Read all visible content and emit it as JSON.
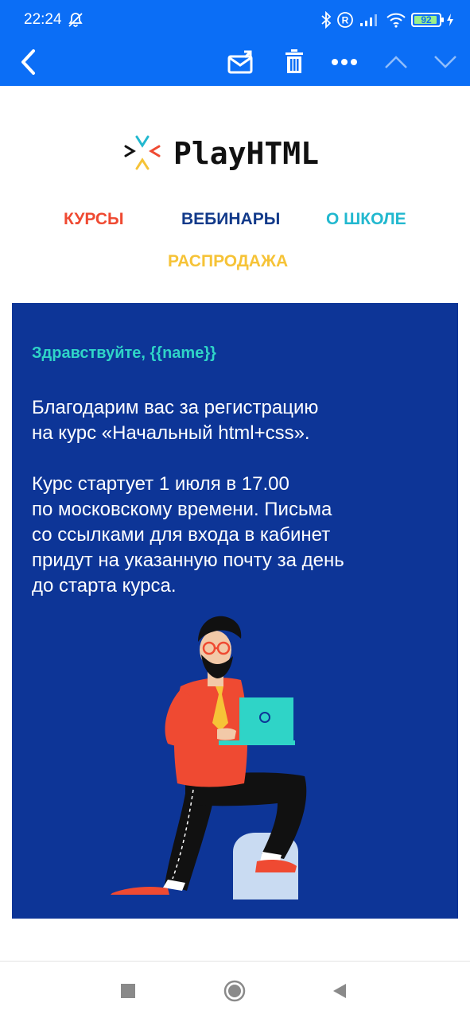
{
  "status_bar": {
    "time": "22:24",
    "battery": "92",
    "battery_level": 0.92
  },
  "app_bar": {
    "actions": [
      "back-icon",
      "move-mail-icon",
      "delete-icon",
      "more-icon",
      "previous-icon",
      "next-icon"
    ]
  },
  "email": {
    "brand": "PlayHTML",
    "nav": {
      "courses": "КУРСЫ",
      "webinars": "ВЕБИНАРЫ",
      "about": "О ШКОЛЕ",
      "sale": "РАСПРОДАЖА"
    },
    "greeting": "Здравствуйте, {{name}}",
    "paragraph1_lines": [
      "Благодарим вас за регистрацию",
      "на курс «Начальный html+css»."
    ],
    "paragraph2_lines": [
      "Курс стартует 1 июля в 17.00",
      "по московскому времени. Письма",
      "со ссылками для входа в кабинет",
      "придут на указанную почту за день",
      "до старта курса."
    ]
  },
  "colors": {
    "app_bar": "#0b6ef6",
    "card_bg": "#0d3597",
    "greeting": "#2fd4c7",
    "nav_courses": "#ef4a32",
    "nav_webinars": "#123a8a",
    "nav_about": "#22b8cf",
    "nav_sale": "#f6c337"
  },
  "system_nav": [
    "recents-icon",
    "home-icon",
    "back-triangle-icon"
  ]
}
